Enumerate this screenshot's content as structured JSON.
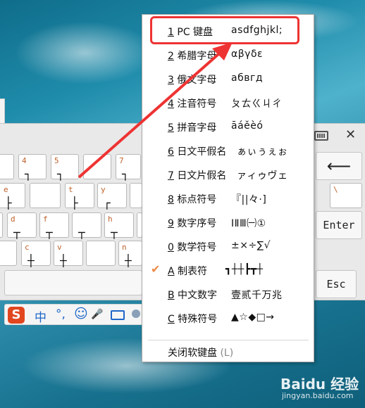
{
  "menu": {
    "items": [
      {
        "num": "1",
        "name": " PC 键盘",
        "preview": "asdfghjkl;",
        "checked": false
      },
      {
        "num": "2",
        "name": " 希腊字母",
        "preview": "αβγδε",
        "checked": false
      },
      {
        "num": "3",
        "name": " 俄文字母",
        "preview": "абвгд",
        "checked": false
      },
      {
        "num": "4",
        "name": " 注音符号",
        "preview": "ㄆㄊㄍㄐㄔ",
        "checked": false
      },
      {
        "num": "5",
        "name": " 拼音字母",
        "preview": "āáěèó",
        "checked": false
      },
      {
        "num": "6",
        "name": " 日文平假名",
        "preview": "ぁぃぅぇぉ",
        "checked": false
      },
      {
        "num": "7",
        "name": " 日文片假名",
        "preview": "ァィゥヴェ",
        "checked": false
      },
      {
        "num": "8",
        "name": " 标点符号",
        "preview": "『||々·]",
        "checked": false
      },
      {
        "num": "9",
        "name": " 数字序号",
        "preview": "ⅠⅡⅢ㈠①",
        "checked": false
      },
      {
        "num": "0",
        "name": " 数学符号",
        "preview": "±×÷∑√",
        "checked": false
      },
      {
        "num": "A",
        "name": " 制表符",
        "preview": "┓┼┼┣┳┼",
        "checked": true
      },
      {
        "num": "B",
        "name": " 中文数字",
        "preview": "壹贰千万兆",
        "checked": false
      },
      {
        "num": "C",
        "name": " 特殊符号",
        "preview": "▲☆◆□→",
        "checked": false
      }
    ],
    "close": {
      "label": "关闭软键盘",
      "hotkey": "(L)"
    },
    "check_mark": "✔"
  },
  "keyboard": {
    "keys": [
      {
        "label": "4",
        "sym": "┐"
      },
      {
        "label": "5",
        "sym": "┐"
      },
      {
        "label": "7",
        "sym": "┐"
      },
      {
        "label": "e",
        "sym": "├"
      },
      {
        "label": "t",
        "sym": "├"
      },
      {
        "label": "y",
        "sym": "┌"
      },
      {
        "label": "d",
        "sym": "┬"
      },
      {
        "label": "f",
        "sym": "┬"
      },
      {
        "label": "g",
        "sym": "┬"
      },
      {
        "label": "h",
        "sym": "┬"
      },
      {
        "label": "c",
        "sym": "┼"
      },
      {
        "label": "v",
        "sym": "┼"
      },
      {
        "label": "n",
        "sym": "┼"
      }
    ],
    "backspace": "⟵",
    "enter": "Enter",
    "esc": "Esc",
    "backslash": "\\",
    "close": "✕"
  },
  "ime_bar": {
    "logo": "S",
    "lang": "中",
    "punct": "°,",
    "emoji": "☺",
    "mic": "🎤"
  },
  "watermark": {
    "brand": "Baidu 经验",
    "url": "jingyan.baidu.com"
  }
}
